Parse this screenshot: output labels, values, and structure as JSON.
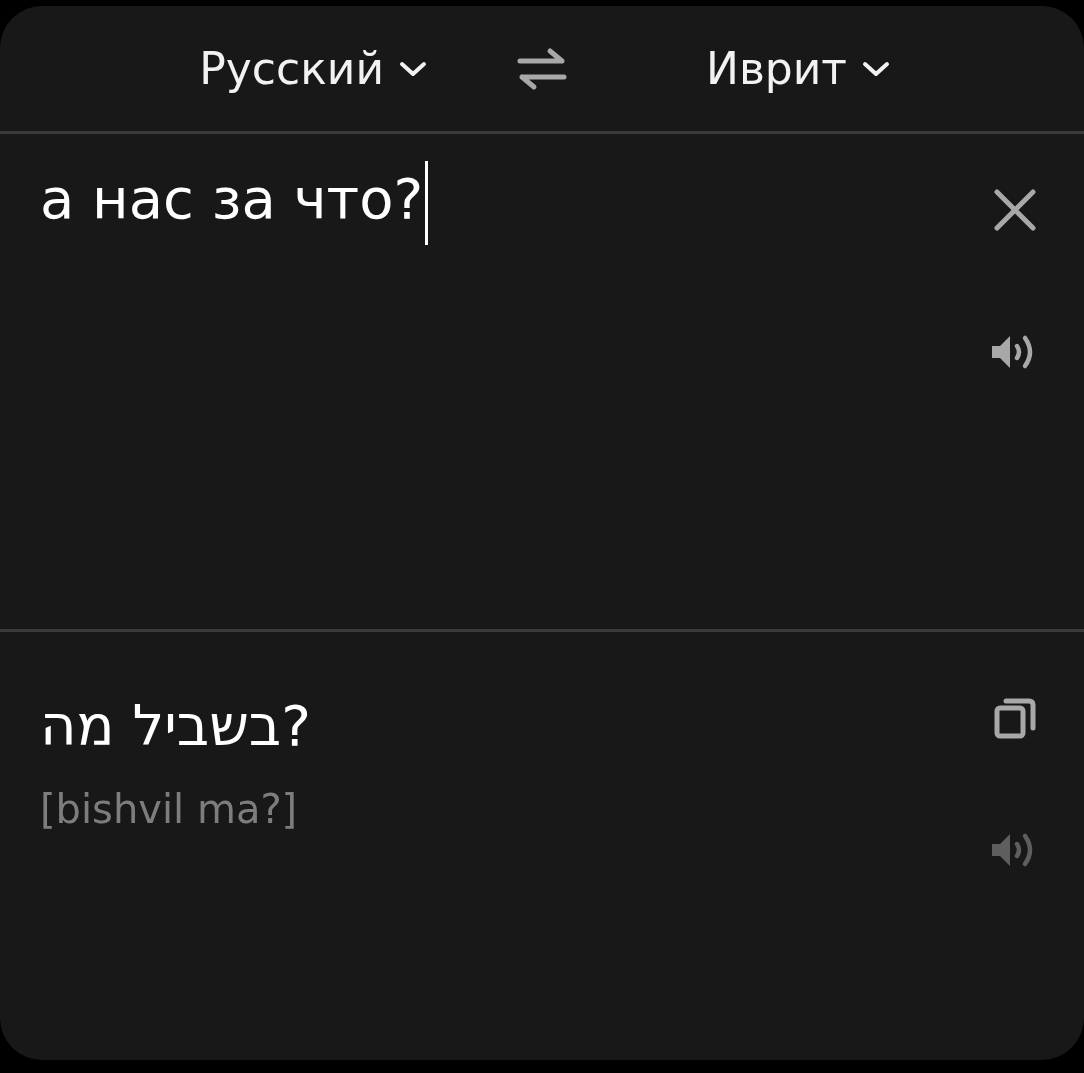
{
  "header": {
    "source_language": "Русский",
    "target_language": "Иврит"
  },
  "input": {
    "value": "а нас за что?",
    "focused": true,
    "speaker": {
      "disabled": false
    }
  },
  "output": {
    "translation": "בשביל מה?",
    "transliteration": "[bishvil ma?]",
    "speaker": {
      "disabled": true
    }
  }
}
